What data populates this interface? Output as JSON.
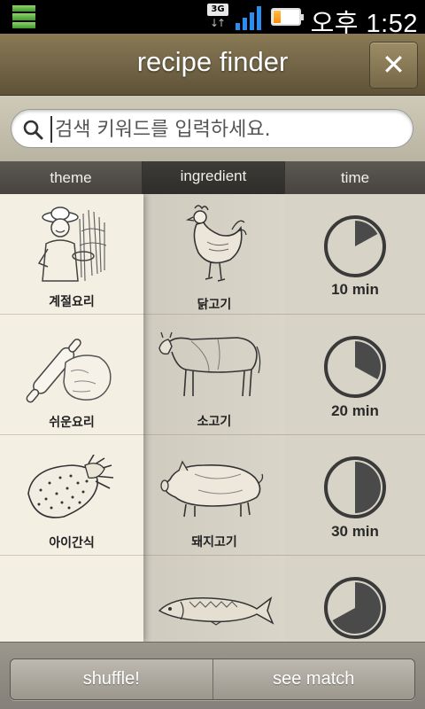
{
  "status_bar": {
    "network": "3G",
    "time": "오후 1:52",
    "battery_level": 0.25
  },
  "header": {
    "title": "recipe finder",
    "close_icon": "close-icon"
  },
  "search": {
    "placeholder": "검색 키워드를 입력하세요.",
    "value": ""
  },
  "tabs": [
    {
      "label": "theme"
    },
    {
      "label": "ingredient"
    },
    {
      "label": "time"
    }
  ],
  "rows": [
    {
      "theme": "계절요리",
      "theme_icon": "harvest-farmer-icon",
      "ingredient": "닭고기",
      "ingredient_icon": "chicken-icon",
      "time": "10 min",
      "time_fraction": 0.17
    },
    {
      "theme": "쉬운요리",
      "theme_icon": "rolling-pin-dough-icon",
      "ingredient": "소고기",
      "ingredient_icon": "cow-icon",
      "time": "20 min",
      "time_fraction": 0.33
    },
    {
      "theme": "아이간식",
      "theme_icon": "strawberry-icon",
      "ingredient": "돼지고기",
      "ingredient_icon": "pig-icon",
      "time": "30 min",
      "time_fraction": 0.5
    },
    {
      "theme": "",
      "theme_icon": "",
      "ingredient": "",
      "ingredient_icon": "fish-icon",
      "time": "",
      "time_fraction": 0.67
    }
  ],
  "bottom_bar": {
    "shuffle_label": "shuffle!",
    "see_match_label": "see match"
  },
  "colors": {
    "header": "#6f6244",
    "signal": "#2a8df0",
    "battery": "#ff8a00",
    "theme_column": "#f3efe3"
  }
}
